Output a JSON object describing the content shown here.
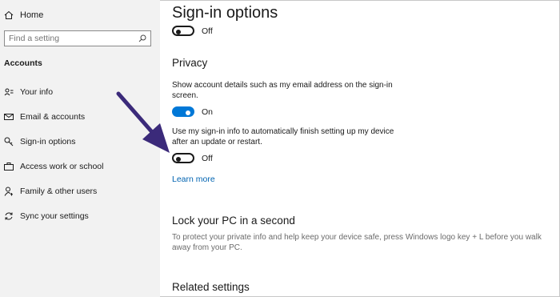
{
  "sidebar": {
    "home_label": "Home",
    "search_placeholder": "Find a setting",
    "section_label": "Accounts",
    "items": [
      {
        "label": "Your info",
        "icon": "person-card-icon"
      },
      {
        "label": "Email & accounts",
        "icon": "mail-icon"
      },
      {
        "label": "Sign-in options",
        "icon": "key-icon"
      },
      {
        "label": "Access work or school",
        "icon": "briefcase-icon"
      },
      {
        "label": "Family & other users",
        "icon": "person-add-icon"
      },
      {
        "label": "Sync your settings",
        "icon": "sync-icon"
      }
    ]
  },
  "main": {
    "title": "Sign-in options",
    "top_toggle": {
      "state": "Off"
    },
    "privacy": {
      "heading": "Privacy",
      "account_details": {
        "text": "Show account details such as my email address on the sign-in screen.",
        "state": "On"
      },
      "auto_finish": {
        "text": "Use my sign-in info to automatically finish setting up my device after an update or restart.",
        "state": "Off"
      },
      "learn_more": "Learn more"
    },
    "lock": {
      "heading": "Lock your PC in a second",
      "text": "To protect your private info and help keep your device safe, press Windows logo key + L before you walk away from your PC."
    },
    "related_heading": "Related settings"
  },
  "colors": {
    "accent": "#0078d7",
    "link": "#0063b1",
    "sidebar_bg": "#f2f2f2",
    "arrow": "#3b2a7a"
  }
}
